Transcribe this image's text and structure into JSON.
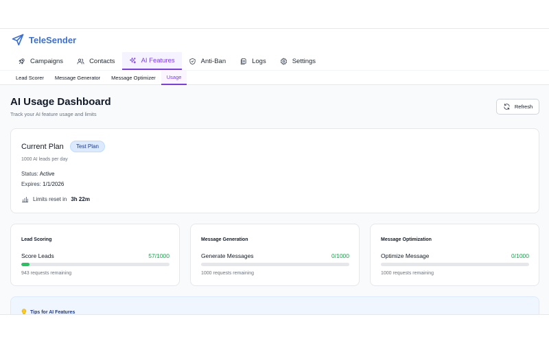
{
  "app": {
    "name": "TeleSender",
    "brand_color": "#3b6fd4",
    "accent_color": "#7c3aed"
  },
  "main_tabs": [
    {
      "label": "Campaigns",
      "icon": "rocket-icon"
    },
    {
      "label": "Contacts",
      "icon": "users-icon"
    },
    {
      "label": "AI Features",
      "icon": "sparkles-icon",
      "active": true
    },
    {
      "label": "Anti-Ban",
      "icon": "shield-icon"
    },
    {
      "label": "Logs",
      "icon": "document-icon"
    },
    {
      "label": "Settings",
      "icon": "gear-icon"
    }
  ],
  "sub_tabs": [
    {
      "label": "Lead Scorer"
    },
    {
      "label": "Message Generator"
    },
    {
      "label": "Message Optimizer"
    },
    {
      "label": "Usage",
      "active": true
    }
  ],
  "page": {
    "title": "AI Usage Dashboard",
    "subtitle": "Track your AI feature usage and limits",
    "refresh_label": "Refresh"
  },
  "plan": {
    "title": "Current Plan",
    "badge": "Test Plan",
    "description": "1000 AI leads per day",
    "status_label": "Status:",
    "status_value": "Active",
    "expires_label": "Expires:",
    "expires_value": "1/1/2026",
    "reset_label": "Limits reset in",
    "reset_value": "3h 22m"
  },
  "usage": [
    {
      "heading": "Lead Scoring",
      "label": "Score Leads",
      "count": "57/1000",
      "used": 57,
      "limit": 1000,
      "remaining": "943 requests remaining"
    },
    {
      "heading": "Message Generation",
      "label": "Generate Messages",
      "count": "0/1000",
      "used": 0,
      "limit": 1000,
      "remaining": "1000 requests remaining"
    },
    {
      "heading": "Message Optimization",
      "label": "Optimize Message",
      "count": "0/1000",
      "used": 0,
      "limit": 1000,
      "remaining": "1000 requests remaining"
    }
  ],
  "tips": {
    "title": "Tips for AI Features",
    "icon": "lightbulb-icon"
  },
  "colors": {
    "progress": "#22c55e",
    "count_text": "#16a34a",
    "badge_bg": "#dbeafe"
  }
}
